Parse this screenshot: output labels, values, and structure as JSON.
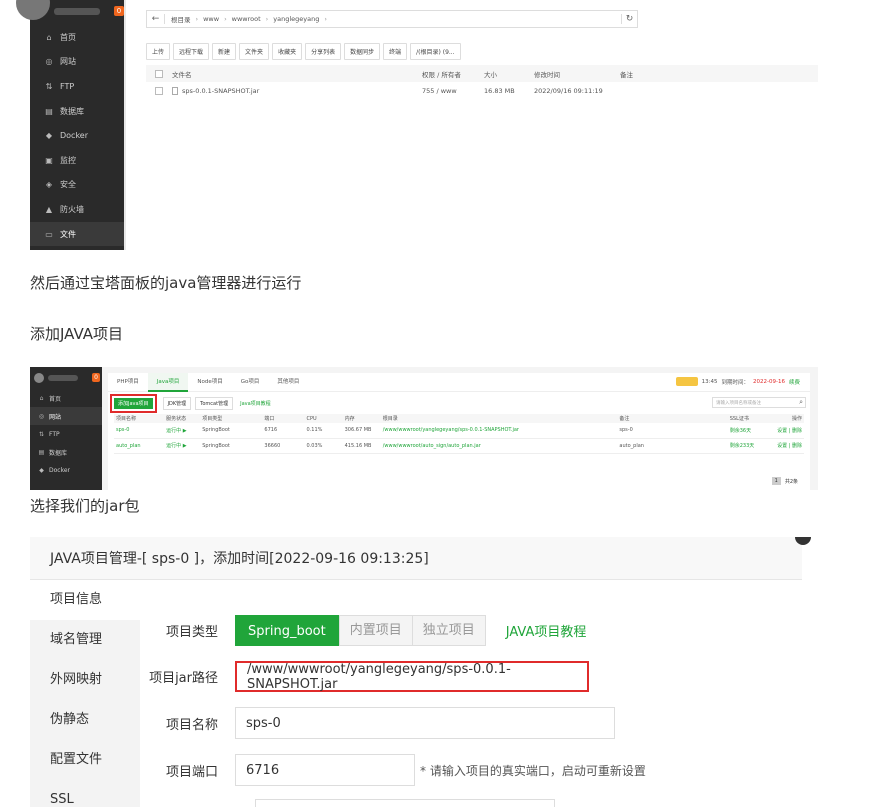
{
  "shot1": {
    "badge": "0",
    "sidebar": [
      {
        "label": "首页",
        "icon": "home-icon",
        "glyph": "⌂"
      },
      {
        "label": "网站",
        "icon": "globe-icon",
        "glyph": "◎"
      },
      {
        "label": "FTP",
        "icon": "ftp-icon",
        "glyph": "⇅"
      },
      {
        "label": "数据库",
        "icon": "database-icon",
        "glyph": "▤"
      },
      {
        "label": "Docker",
        "icon": "docker-icon",
        "glyph": "◆"
      },
      {
        "label": "监控",
        "icon": "monitor-icon",
        "glyph": "▣"
      },
      {
        "label": "安全",
        "icon": "shield-icon",
        "glyph": "◈"
      },
      {
        "label": "防火墙",
        "icon": "firewall-icon",
        "glyph": "▲"
      },
      {
        "label": "文件",
        "icon": "folder-icon",
        "glyph": "▭"
      }
    ],
    "breadcrumb": [
      "根目录",
      "www",
      "wwwroot",
      "yanglegeyang"
    ],
    "toolbar": [
      "上传",
      "远程下载",
      "新建",
      "文件夹",
      "收藏夹",
      "分享列表",
      "数据同步",
      "终端",
      "/(根目录) (9..."
    ],
    "columns": [
      "文件名",
      "权限 / 所有者",
      "大小",
      "修改时间",
      "备注"
    ],
    "files": [
      {
        "name": "sps-0.0.1-SNAPSHOT.jar",
        "perm": "755 / www",
        "size": "16.83 MB",
        "mtime": "2022/09/16 09:11:19",
        "note": ""
      }
    ]
  },
  "text1": "然后通过宝塔面板的java管理器进行运行",
  "text2": "添加JAVA项目",
  "shot2": {
    "badge": "0",
    "sidebar": [
      {
        "label": "首页",
        "icon": "home-icon",
        "glyph": "⌂"
      },
      {
        "label": "网站",
        "icon": "globe-icon",
        "glyph": "◎"
      },
      {
        "label": "FTP",
        "icon": "ftp-icon",
        "glyph": "⇅"
      },
      {
        "label": "数据库",
        "icon": "database-icon",
        "glyph": "▤"
      },
      {
        "label": "Docker",
        "icon": "docker-icon",
        "glyph": "◆"
      }
    ],
    "tabs": [
      "PHP项目",
      "Java项目",
      "Node项目",
      "Go项目",
      "其他项目"
    ],
    "top_right": {
      "time": "13:45",
      "expire_label": "到期时间：",
      "expire_date": "2022-09-16",
      "renew": "续费"
    },
    "actions": {
      "add": "添加Java项目",
      "jdk": "JDK管理",
      "tomcat": "Tomcat管理",
      "tutorial": "Java项目教程"
    },
    "search_placeholder": "请输入项目名称或备注",
    "columns": [
      "项目名称",
      "服务状态",
      "项目类型",
      "端口",
      "CPU",
      "内存",
      "根目录",
      "备注",
      "SSL证书",
      "操作"
    ],
    "rows": [
      {
        "name": "sps-0",
        "status": "运行中 ▶",
        "type": "SpringBoot",
        "port": "6716",
        "cpu": "0.11%",
        "mem": "306.67 MB",
        "root": "/www/wwwroot/yanglegeyang/sps-0.0.1-SNAPSHOT.jar",
        "note": "sps-0",
        "ssl": "剩余36天",
        "ops": "设置 | 删除"
      },
      {
        "name": "auto_plan",
        "status": "运行中 ▶",
        "type": "SpringBoot",
        "port": "36660",
        "cpu": "0.03%",
        "mem": "415.16 MB",
        "root": "/www/wwwroot/auto_sign/auto_plan.jar",
        "note": "auto_plan",
        "ssl": "剩余233天",
        "ops": "设置 | 删除"
      }
    ],
    "page_num": "1",
    "total": "共2条"
  },
  "text3": "选择我们的jar包",
  "shot3": {
    "title": "JAVA项目管理-[ sps-0 ]，添加时间[2022-09-16 09:13:25]",
    "side_tabs": [
      "项目信息",
      "域名管理",
      "外网映射",
      "伪静态",
      "配置文件",
      "SSL"
    ],
    "type_label": "项目类型",
    "type_options": [
      "Spring_boot",
      "内置项目",
      "独立项目"
    ],
    "tutorial": "JAVA项目教程",
    "jar_label": "项目jar路径",
    "jar_value": "/www/wwwroot/yanglegeyang/sps-0.0.1-SNAPSHOT.jar",
    "name_label": "项目名称",
    "name_value": "sps-0",
    "port_label": "项目端口",
    "port_value": "6716",
    "port_hint": "* 请输入项目的真实端口，启动可重新设置"
  },
  "colors": {
    "accent": "#20a53a",
    "danger": "#e02b2b",
    "sidebar": "#2a2a2a",
    "badge": "#f0661e"
  }
}
